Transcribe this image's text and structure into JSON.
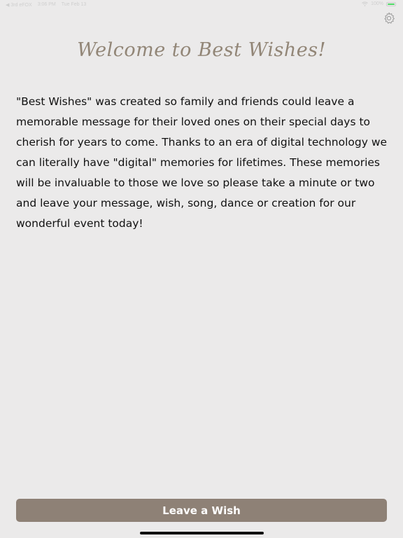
{
  "status_bar": {
    "back_label": "◀ 3rd eFOX",
    "time": "3:06 PM",
    "date": "Tue Feb 13",
    "battery_text": "100%",
    "battery_level": 1.0,
    "battery_color": "#4cd964"
  },
  "header": {
    "title": "Welcome to Best Wishes!",
    "settings_icon": "gear-icon"
  },
  "main": {
    "body_text": "\"Best Wishes\" was created so family and friends could leave a memorable message for their loved ones on their special days to cherish for years to come.  Thanks to an era of digital technology we can literally have \"digital\" memories for lifetimes.  These memories will be invaluable to those we love so please take a minute or two and leave your message, wish, song, dance or creation for our wonderful event today!"
  },
  "footer": {
    "button_label": "Leave a Wish"
  },
  "colors": {
    "background": "#ebeaea",
    "accent": "#8e8176",
    "title": "#928677"
  }
}
